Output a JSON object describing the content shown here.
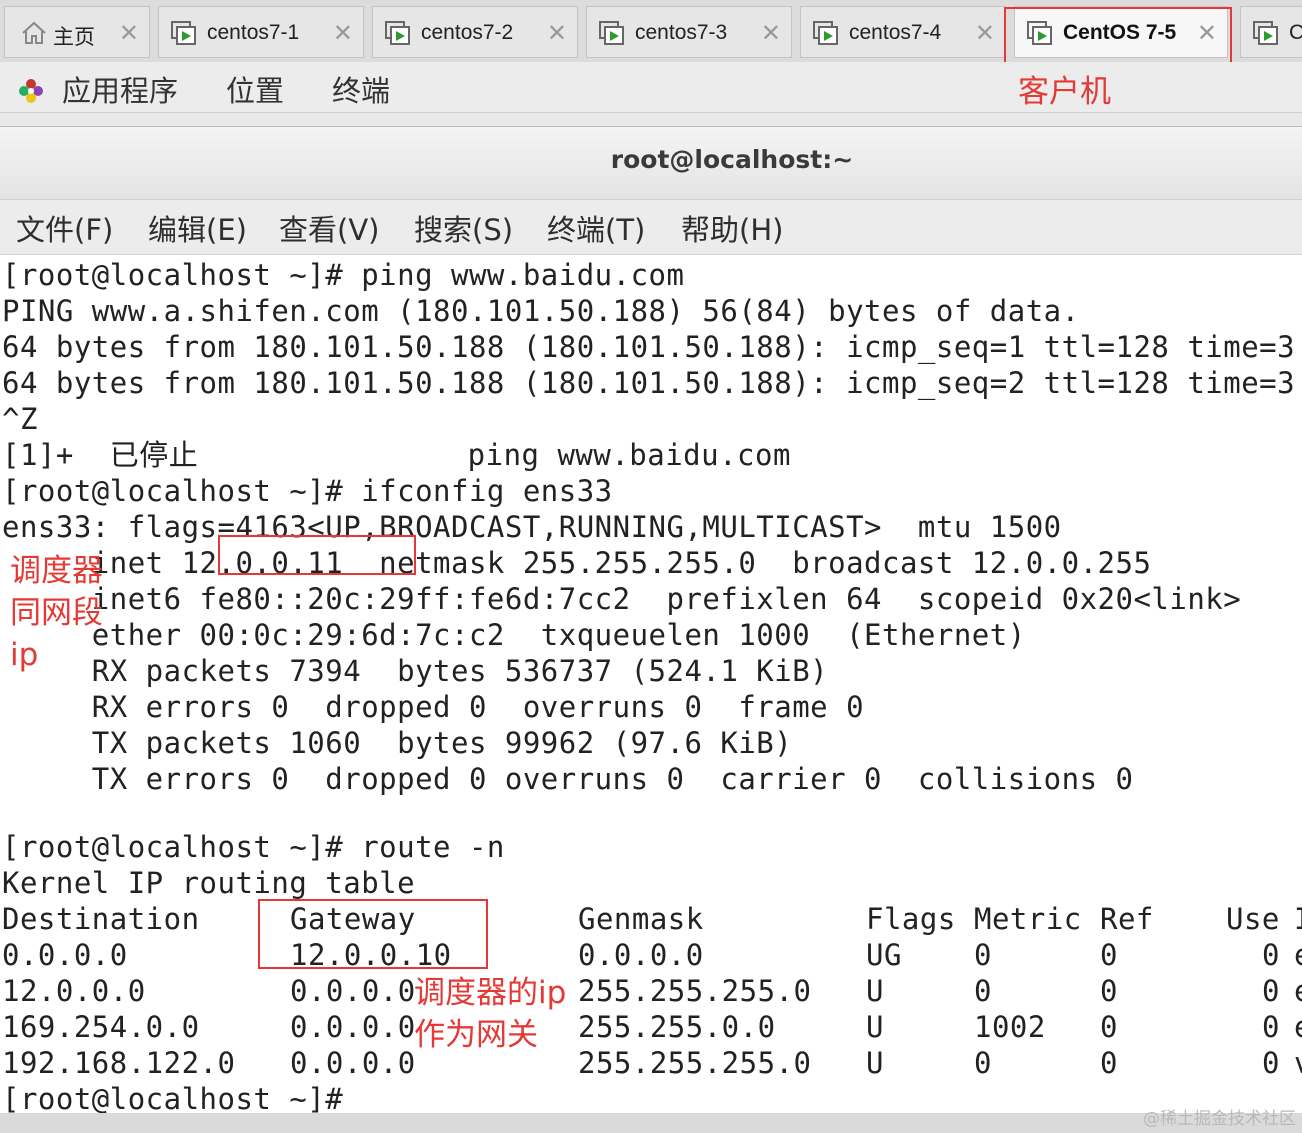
{
  "tabs": [
    {
      "label": "主页",
      "icon": "home-icon"
    },
    {
      "label": "centos7-1",
      "icon": "vm-icon"
    },
    {
      "label": "centos7-2",
      "icon": "vm-icon"
    },
    {
      "label": "centos7-3",
      "icon": "vm-icon"
    },
    {
      "label": "centos7-4",
      "icon": "vm-icon"
    },
    {
      "label": "CentOS 7-5",
      "icon": "vm-icon",
      "active": true
    },
    {
      "label": "C",
      "icon": "vm-icon"
    }
  ],
  "topbar": {
    "applications": "应用程序",
    "places": "位置",
    "terminal": "终端"
  },
  "window": {
    "title": "root@localhost:~"
  },
  "menu": [
    "文件(F)",
    "编辑(E)",
    "查看(V)",
    "搜索(S)",
    "终端(T)",
    "帮助(H)"
  ],
  "terminal": {
    "lines": [
      "[root@localhost ~]# ping www.baidu.com",
      "PING www.a.shifen.com (180.101.50.188) 56(84) bytes of data.",
      "64 bytes from 180.101.50.188 (180.101.50.188): icmp_seq=1 ttl=128 time=3.",
      "64 bytes from 180.101.50.188 (180.101.50.188): icmp_seq=2 ttl=128 time=3.",
      "^Z",
      "[1]+  已停止               ping www.baidu.com",
      "[root@localhost ~]# ifconfig ens33",
      "ens33: flags=4163<UP,BROADCAST,RUNNING,MULTICAST>  mtu 1500",
      "     inet 12.0.0.11  netmask 255.255.255.0  broadcast 12.0.0.255",
      "     inet6 fe80::20c:29ff:fe6d:7cc2  prefixlen 64  scopeid 0x20<link>",
      "     ether 00:0c:29:6d:7c:c2  txqueuelen 1000  (Ethernet)",
      "     RX packets 7394  bytes 536737 (524.1 KiB)",
      "     RX errors 0  dropped 0  overruns 0  frame 0",
      "     TX packets 1060  bytes 99962 (97.6 KiB)",
      "     TX errors 0  dropped 0 overruns 0  carrier 0  collisions 0",
      "",
      "[root@localhost ~]# route -n",
      "Kernel IP routing table"
    ],
    "route_table": {
      "headers": [
        "Destination",
        "Gateway",
        "Genmask",
        "Flags",
        "Metric",
        "Ref",
        "Use",
        "I"
      ],
      "rows": [
        [
          "0.0.0.0",
          "12.0.0.10",
          "0.0.0.0",
          "UG",
          "0",
          "0",
          "0",
          "e"
        ],
        [
          "12.0.0.0",
          "0.0.0.0",
          "255.255.255.0",
          "U",
          "0",
          "0",
          "0",
          "e"
        ],
        [
          "169.254.0.0",
          "0.0.0.0",
          "255.255.0.0",
          "U",
          "1002",
          "0",
          "0",
          "e"
        ],
        [
          "192.168.122.0",
          "0.0.0.0",
          "255.255.255.0",
          "U",
          "0",
          "0",
          "0",
          "v"
        ]
      ]
    },
    "prompt": "[root@localhost ~]#"
  },
  "annotations": {
    "client": "客户机",
    "same_segment": [
      "调度器",
      "同网段",
      "ip"
    ],
    "gateway_note": [
      "调度器的ip",
      "作为网关"
    ]
  },
  "watermark": "@稀土掘金技术社区",
  "colors": {
    "annotation": "#e53935"
  }
}
